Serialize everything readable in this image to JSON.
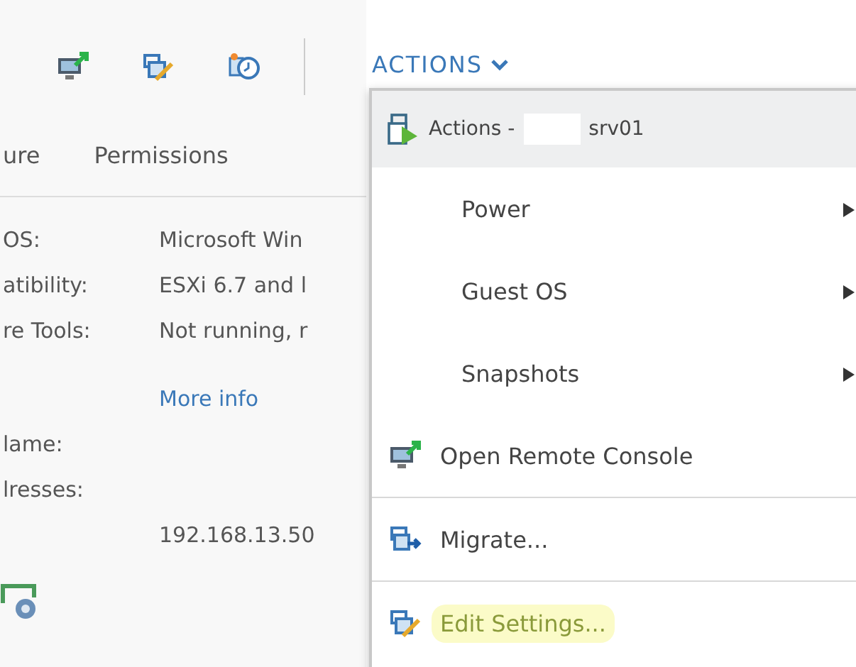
{
  "toolbar": {
    "actions_label": "ACTIONS"
  },
  "tabs": [
    {
      "label": "ure",
      "selected": false
    },
    {
      "label": "Permissions",
      "selected": false
    }
  ],
  "properties": [
    {
      "label": "OS:",
      "value": "Microsoft Win"
    },
    {
      "label": "atibility:",
      "value": "ESXi 6.7 and l"
    },
    {
      "label": "re Tools:",
      "value": "Not running, r"
    },
    {
      "value": "More info",
      "kind": "link"
    },
    {
      "label": "lame:"
    },
    {
      "label": "lresses:"
    },
    {
      "value": "192.168.13.50"
    }
  ],
  "menu": {
    "header_prefix": "Actions -",
    "header_suffix": "srv01",
    "items": [
      {
        "label": "Power",
        "kind": "submenu",
        "highlighted": false
      },
      {
        "label": "Guest OS",
        "kind": "submenu",
        "highlighted": false
      },
      {
        "label": "Snapshots",
        "kind": "submenu",
        "highlighted": false
      },
      {
        "label": "Open Remote Console",
        "kind": "console",
        "highlighted": false
      },
      {
        "label": "Migrate...",
        "kind": "migrate",
        "highlighted": false
      },
      {
        "label": "Edit Settings...",
        "kind": "edit",
        "highlighted": true
      }
    ]
  }
}
